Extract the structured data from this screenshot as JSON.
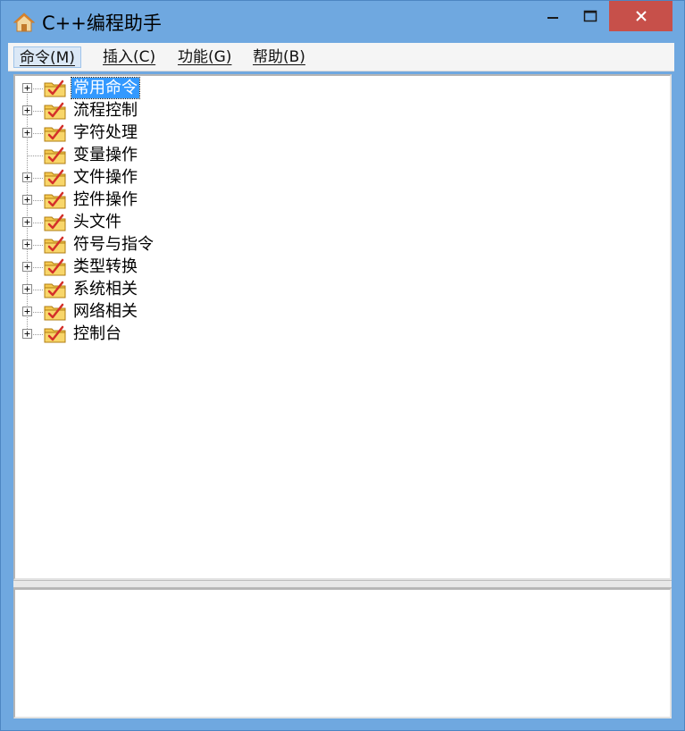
{
  "window": {
    "title": "C++编程助手",
    "icon": "home-icon"
  },
  "controls": {
    "minimize_icon": "minimize-icon",
    "maximize_icon": "maximize-icon",
    "close_icon": "close-icon"
  },
  "menu": {
    "items": [
      {
        "label": "命令(M)",
        "active": true
      },
      {
        "label": "插入(C)",
        "active": false
      },
      {
        "label": "功能(G)",
        "active": false
      },
      {
        "label": "帮助(B)",
        "active": false
      }
    ]
  },
  "tree": {
    "items": [
      {
        "label": "常用命令",
        "expandable": true,
        "selected": true
      },
      {
        "label": "流程控制",
        "expandable": true,
        "selected": false
      },
      {
        "label": "字符处理",
        "expandable": true,
        "selected": false
      },
      {
        "label": "变量操作",
        "expandable": false,
        "selected": false
      },
      {
        "label": "文件操作",
        "expandable": true,
        "selected": false
      },
      {
        "label": "控件操作",
        "expandable": true,
        "selected": false
      },
      {
        "label": "头文件",
        "expandable": true,
        "selected": false
      },
      {
        "label": "符号与指令",
        "expandable": true,
        "selected": false
      },
      {
        "label": "类型转换",
        "expandable": true,
        "selected": false
      },
      {
        "label": "系统相关",
        "expandable": true,
        "selected": false
      },
      {
        "label": "网络相关",
        "expandable": true,
        "selected": false
      },
      {
        "label": "控制台",
        "expandable": true,
        "selected": false
      }
    ]
  },
  "colors": {
    "titlebar": "#6fa8e0",
    "close_button": "#c7504a",
    "selection": "#3399ff",
    "folder": "#f4c84e",
    "check": "#d4302a"
  }
}
